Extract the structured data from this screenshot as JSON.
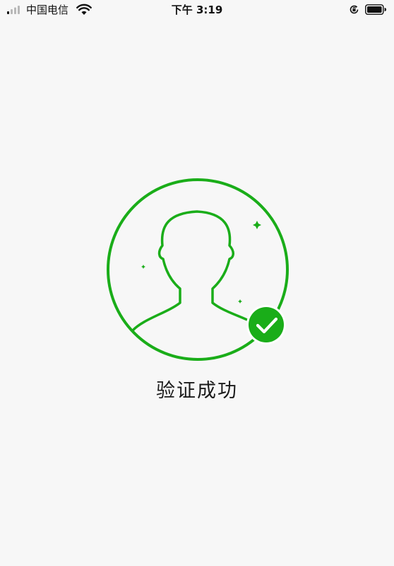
{
  "status_bar": {
    "carrier": "中国电信",
    "time": "下午 3:19",
    "icons": [
      "signal-icon",
      "wifi-icon",
      "rotation-lock-icon",
      "battery-icon"
    ]
  },
  "verification": {
    "message": "验证成功",
    "status_icon": "checkmark-icon",
    "avatar_icon": "person-silhouette-icon"
  },
  "colors": {
    "accent": "#1aad19",
    "background": "#f7f7f7",
    "text": "#1a1a1a"
  }
}
